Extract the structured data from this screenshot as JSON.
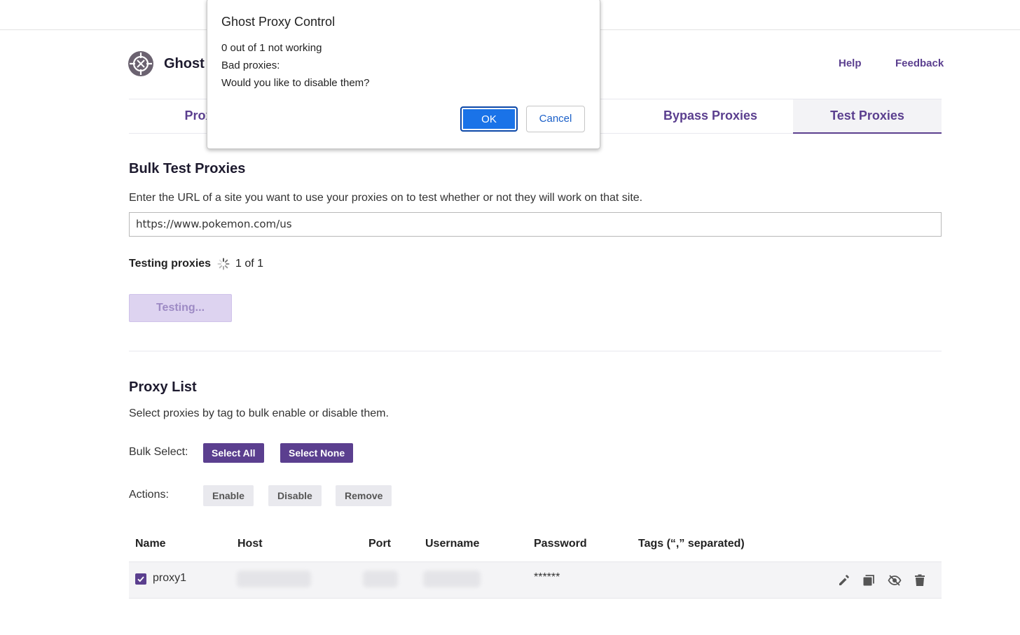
{
  "app": {
    "brand": "Ghost",
    "help_link": "Help",
    "feedback_link": "Feedback"
  },
  "tabs": [
    {
      "label": "Proxy L",
      "active": false
    },
    {
      "label": "Bypass Proxies",
      "active": false
    },
    {
      "label": "Test Proxies",
      "active": true
    }
  ],
  "bulk_test": {
    "title": "Bulk Test Proxies",
    "description": "Enter the URL of a site you want to use your proxies on to test whether or not they will work on that site.",
    "url_value": "https://www.pokemon.com/us",
    "status_label": "Testing proxies",
    "progress": "1 of 1",
    "button_label": "Testing..."
  },
  "proxy_list": {
    "title": "Proxy List",
    "description": "Select proxies by tag to bulk enable or disable them.",
    "bulk_select_label": "Bulk Select:",
    "select_all": "Select All",
    "select_none": "Select None",
    "actions_label": "Actions:",
    "enable": "Enable",
    "disable": "Disable",
    "remove": "Remove",
    "columns": [
      "Name",
      "Host",
      "Port",
      "Username",
      "Password",
      "Tags (“,” separated)"
    ],
    "rows": [
      {
        "checked": true,
        "name": "proxy1",
        "host": "",
        "port": "",
        "username": "",
        "password": "******",
        "tags": ""
      }
    ],
    "row_icons": [
      "edit-icon",
      "copy-icon",
      "hide-icon",
      "delete-icon"
    ]
  },
  "dialog": {
    "title": "Ghost Proxy Control",
    "lines": [
      "0 out of 1 not working",
      "Bad proxies:",
      "Would you like to disable them?"
    ],
    "ok": "OK",
    "cancel": "Cancel"
  },
  "colors": {
    "brand_purple": "#5b3f8f",
    "ok_blue": "#1a73e8",
    "disabled_button": "#ddd3f0"
  }
}
